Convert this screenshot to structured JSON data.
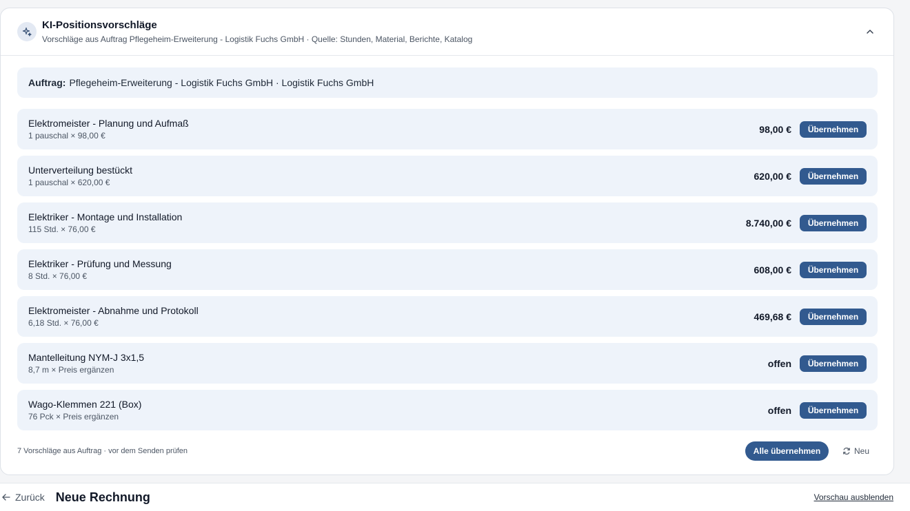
{
  "header": {
    "title": "KI-Positionsvorschläge",
    "subtitle": "Vorschläge aus Auftrag Pflegeheim-Erweiterung - Logistik Fuchs GmbH · Quelle: Stunden, Material, Berichte, Katalog",
    "icon": "sparkles-icon",
    "collapse_icon": "chevron-up-icon"
  },
  "order": {
    "label": "Auftrag:",
    "value": "Pflegeheim-Erweiterung - Logistik Fuchs GmbH · Logistik Fuchs GmbH"
  },
  "items": [
    {
      "name": "Elektromeister - Planung und Aufmaß",
      "detail": "1 pauschal × 98,00 €",
      "amount": "98,00 €",
      "button": "Übernehmen"
    },
    {
      "name": "Unterverteilung bestückt",
      "detail": "1 pauschal × 620,00 €",
      "amount": "620,00 €",
      "button": "Übernehmen"
    },
    {
      "name": "Elektriker - Montage und Installation",
      "detail": "115 Std. × 76,00 €",
      "amount": "8.740,00 €",
      "button": "Übernehmen"
    },
    {
      "name": "Elektriker - Prüfung und Messung",
      "detail": "8 Std. × 76,00 €",
      "amount": "608,00 €",
      "button": "Übernehmen"
    },
    {
      "name": "Elektromeister - Abnahme und Protokoll",
      "detail": "6,18 Std. × 76,00 €",
      "amount": "469,68 €",
      "button": "Übernehmen"
    },
    {
      "name": "Mantelleitung NYM-J 3x1,5",
      "detail": "8,7 m × Preis ergänzen",
      "amount": "offen",
      "button": "Übernehmen"
    },
    {
      "name": "Wago-Klemmen 221 (Box)",
      "detail": "76 Pck × Preis ergänzen",
      "amount": "offen",
      "button": "Übernehmen"
    }
  ],
  "footer": {
    "note": "7 Vorschläge aus Auftrag · vor dem Senden prüfen",
    "accept_all": "Alle übernehmen",
    "refresh": "Neu"
  },
  "bottom_bar": {
    "back": "Zurück",
    "title": "Neue Rechnung",
    "hide_preview": "Vorschau ausblenden"
  },
  "colors": {
    "accent": "#325a8f",
    "card_bg": "#eef3fa"
  }
}
